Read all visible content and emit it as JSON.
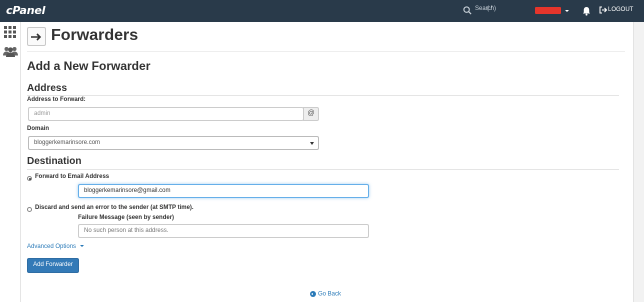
{
  "topbar": {
    "logo": "cPanel",
    "search_placeholder": "Search",
    "search_shortcut": "( / )",
    "user_label": "",
    "logout_label": "LOGOUT",
    "background": "#293a4a"
  },
  "page": {
    "title": "Forwarders"
  },
  "form": {
    "heading": "Add a New Forwarder",
    "address": {
      "heading": "Address",
      "address_label": "Address to Forward:",
      "address_value": "admin",
      "at_symbol": "@",
      "domain_label": "Domain",
      "domain_value": "bloggerkemarinsore.com"
    },
    "destination": {
      "heading": "Destination",
      "forward_label": "Forward to Email Address",
      "forward_value": "bloggerkemarinsore@gmail.com",
      "forward_selected": true,
      "discard_label": "Discard and send an error to the sender (at SMTP time).",
      "failure_label": "Failure Message (seen by sender)",
      "failure_value": "No such person at this address."
    },
    "advanced_options": "Advanced Options",
    "submit_label": "Add Forwarder"
  },
  "footer": {
    "go_back": "Go Back"
  },
  "colors": {
    "accent": "#337ab7",
    "link": "#2a7ab8"
  }
}
